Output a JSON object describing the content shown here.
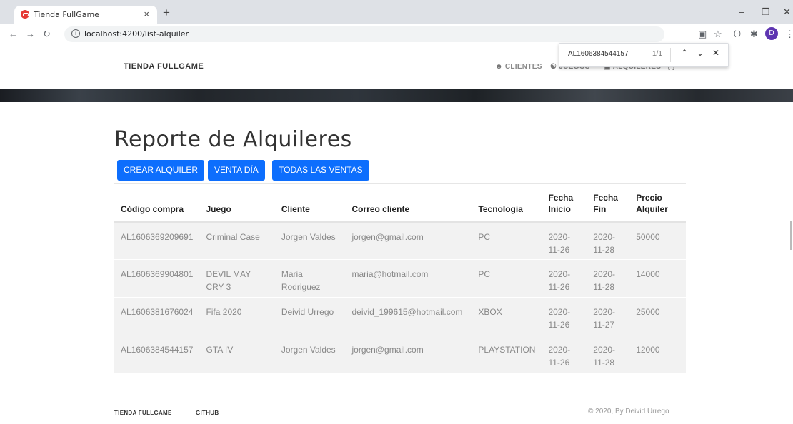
{
  "browser": {
    "tab_title": "Tienda FullGame",
    "tab_close": "×",
    "new_tab": "+",
    "url": "localhost:4200/list-alquiler",
    "avatar_letter": "D",
    "find": {
      "query": "AL1606384544157",
      "count": "1/1"
    }
  },
  "navbar": {
    "brand": "TIENDA FULLGAME",
    "items": [
      {
        "label": "CLIENTES",
        "icon": "users-icon"
      },
      {
        "label": "JUEGOS",
        "icon": "gamepad-icon"
      },
      {
        "label": "ALQUILERES",
        "icon": "car-icon"
      },
      {
        "label": "{ }",
        "icon": "braces-icon"
      }
    ]
  },
  "main": {
    "title": "Reporte de Alquileres",
    "buttons": {
      "create": "CREAR ALQUILER",
      "sale_day": "VENTA DÍA",
      "all_sales": "TODAS LAS VENTAS"
    },
    "table": {
      "headers": [
        "Código compra",
        "Juego",
        "Cliente",
        "Correo cliente",
        "Tecnologia",
        "Fecha Inicio",
        "Fecha Fin",
        "Precio Alquiler"
      ],
      "rows": [
        [
          "AL1606369209691",
          "Criminal Case",
          "Jorgen Valdes",
          "jorgen@gmail.com",
          "PC",
          "2020-11-26",
          "2020-11-28",
          "50000"
        ],
        [
          "AL1606369904801",
          "DEVIL MAY CRY 3",
          "Maria Rodriguez",
          "maria@hotmail.com",
          "PC",
          "2020-11-26",
          "2020-11-28",
          "14000"
        ],
        [
          "AL1606381676024",
          "Fifa 2020",
          "Deivid Urrego",
          "deivid_199615@hotmail.com",
          "XBOX",
          "2020-11-26",
          "2020-11-27",
          "25000"
        ],
        [
          "AL1606384544157",
          "GTA IV",
          "Jorgen Valdes",
          "jorgen@gmail.com",
          "PLAYSTATION",
          "2020-11-26",
          "2020-11-28",
          "12000"
        ]
      ]
    }
  },
  "footer": {
    "brand": "TIENDA FULLGAME",
    "github": "GITHUB",
    "copyright": "© 2020, By Deivid Urrego"
  },
  "colors": {
    "primary_button": "#0d6efd",
    "row_background": "#f2f2f2"
  }
}
